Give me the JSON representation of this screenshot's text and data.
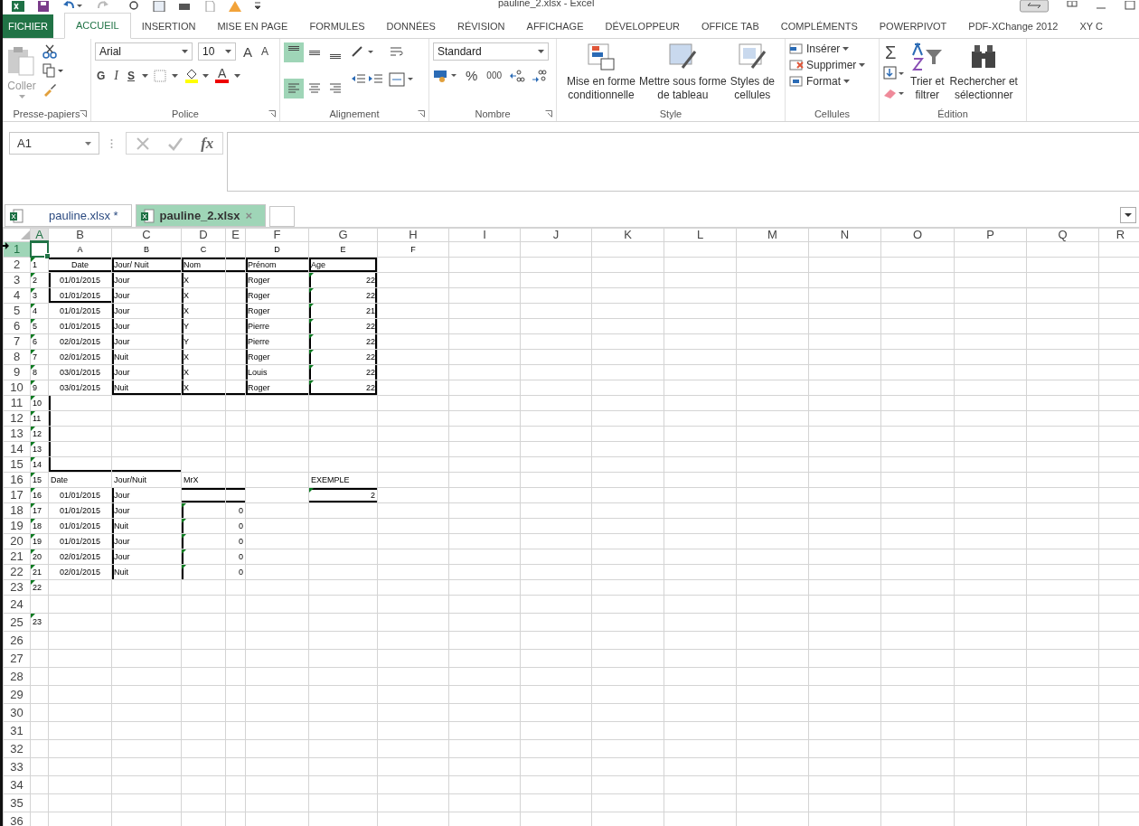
{
  "window": {
    "title": "pauline_2.xlsx - Excel"
  },
  "tabs": [
    {
      "label": "FICHIER",
      "kind": "file",
      "selected": false
    },
    {
      "label": "ACCUEIL",
      "kind": "tab",
      "selected": true
    },
    {
      "label": "INSERTION",
      "kind": "tab",
      "selected": false
    },
    {
      "label": "MISE EN PAGE",
      "kind": "tab",
      "selected": false
    },
    {
      "label": "FORMULES",
      "kind": "tab",
      "selected": false
    },
    {
      "label": "DONNÉES",
      "kind": "tab",
      "selected": false
    },
    {
      "label": "RÉVISION",
      "kind": "tab",
      "selected": false
    },
    {
      "label": "AFFICHAGE",
      "kind": "tab",
      "selected": false
    },
    {
      "label": "DÉVELOPPEUR",
      "kind": "tab",
      "selected": false
    },
    {
      "label": "OFFICE TAB",
      "kind": "tab",
      "selected": false
    },
    {
      "label": "COMPLÉMENTS",
      "kind": "tab",
      "selected": false
    },
    {
      "label": "POWERPIVOT",
      "kind": "tab",
      "selected": false
    },
    {
      "label": "PDF-XChange 2012",
      "kind": "tab",
      "selected": false
    },
    {
      "label": "XY C",
      "kind": "tab",
      "selected": false
    }
  ],
  "ribbon": {
    "clipboard": {
      "label": "Presse-papiers",
      "paste": "Coller"
    },
    "font": {
      "label": "Police",
      "font_name": "Arial",
      "font_size": "10",
      "grow": "A",
      "shrink": "A",
      "bold": "G",
      "italic": "I",
      "underline": "S",
      "font_color": "A"
    },
    "alignment": {
      "label": "Alignement",
      "buttons": [
        {
          "kind": "top",
          "selected": true
        },
        {
          "kind": "middle",
          "selected": false
        },
        {
          "kind": "bottom",
          "selected": false
        },
        {
          "kind": "left",
          "selected": true
        },
        {
          "kind": "center",
          "selected": false
        },
        {
          "kind": "right",
          "selected": false
        }
      ]
    },
    "number": {
      "label": "Nombre",
      "format": "Standard",
      "percent": "%",
      "thousands": "000"
    },
    "styles": {
      "label": "Style",
      "buttons": [
        {
          "kind": "conditional",
          "lines": [
            "Mise en forme",
            "conditionnelle"
          ]
        },
        {
          "kind": "table",
          "lines": [
            "Mettre sous forme",
            "de tableau"
          ]
        },
        {
          "kind": "cellstyle",
          "lines": [
            "Styles de",
            "cellules"
          ]
        }
      ]
    },
    "cells": {
      "label": "Cellules",
      "buttons": [
        {
          "kind": "insert",
          "label": "Insérer"
        },
        {
          "kind": "delete",
          "label": "Supprimer"
        },
        {
          "kind": "format",
          "label": "Format"
        }
      ]
    },
    "editing": {
      "label": "Édition",
      "sum": "Σ",
      "buttons": [
        {
          "kind": "sort",
          "lines": [
            "Trier et",
            "filtrer"
          ]
        },
        {
          "kind": "find",
          "lines": [
            "Rechercher et",
            "sélectionner"
          ]
        }
      ]
    }
  },
  "formula_bar": {
    "name_box": "A1",
    "fx": "fx"
  },
  "workbooks": [
    {
      "label": "pauline.xlsx *",
      "selected": false
    },
    {
      "label": "pauline_2.xlsx",
      "selected": true,
      "close": "×"
    }
  ],
  "sheet": {
    "columns": [
      {
        "label": "A",
        "selected": true
      },
      {
        "label": "B",
        "selected": false
      },
      {
        "label": "C",
        "selected": false
      },
      {
        "label": "D",
        "selected": false
      },
      {
        "label": "E",
        "selected": false
      },
      {
        "label": "F",
        "selected": false
      },
      {
        "label": "G",
        "selected": false
      },
      {
        "label": "H",
        "selected": false
      },
      {
        "label": "I",
        "selected": false
      },
      {
        "label": "J",
        "selected": false
      },
      {
        "label": "K",
        "selected": false
      },
      {
        "label": "L",
        "selected": false
      },
      {
        "label": "M",
        "selected": false
      },
      {
        "label": "N",
        "selected": false
      },
      {
        "label": "O",
        "selected": false
      },
      {
        "label": "P",
        "selected": false
      },
      {
        "label": "Q",
        "selected": false
      },
      {
        "label": "R",
        "selected": false
      }
    ],
    "rows": [
      {
        "header": "1",
        "selected": true,
        "cells": {
          "B": {
            "text": "A"
          },
          "C": {
            "text": "B"
          },
          "D": {
            "text": "C"
          },
          "F": {
            "text": "D"
          },
          "G": {
            "text": "E"
          },
          "H": {
            "text": "F"
          }
        }
      },
      {
        "header": "2",
        "selected": false,
        "cells": {
          "A": {
            "text": "1",
            "warning": true
          },
          "B": {
            "text": "Date"
          },
          "C": {
            "text": "Jour/ Nuit"
          },
          "D": {
            "text": "Nom"
          },
          "F": {
            "text": "Prénom"
          },
          "G": {
            "text": "Age"
          }
        }
      },
      {
        "header": "3",
        "selected": false,
        "cells": {
          "A": {
            "text": "2",
            "warning": true
          },
          "B": {
            "text": "01/01/2015"
          },
          "C": {
            "text": "Jour"
          },
          "D": {
            "text": "X"
          },
          "F": {
            "text": "Roger"
          },
          "G": {
            "text": "22",
            "warning": true
          }
        }
      },
      {
        "header": "4",
        "selected": false,
        "cells": {
          "A": {
            "text": "3",
            "warning": true
          },
          "B": {
            "text": "01/01/2015"
          },
          "C": {
            "text": "Jour"
          },
          "D": {
            "text": "X"
          },
          "F": {
            "text": "Roger"
          },
          "G": {
            "text": "22",
            "warning": true
          }
        }
      },
      {
        "header": "5",
        "selected": false,
        "cells": {
          "A": {
            "text": "4",
            "warning": true
          },
          "B": {
            "text": "01/01/2015"
          },
          "C": {
            "text": "Jour"
          },
          "D": {
            "text": "X"
          },
          "F": {
            "text": "Roger"
          },
          "G": {
            "text": "21",
            "warning": true
          }
        }
      },
      {
        "header": "6",
        "selected": false,
        "cells": {
          "A": {
            "text": "5",
            "warning": true
          },
          "B": {
            "text": "01/01/2015"
          },
          "C": {
            "text": "Jour"
          },
          "D": {
            "text": "Y"
          },
          "F": {
            "text": "Pierre"
          },
          "G": {
            "text": "22",
            "warning": true
          }
        }
      },
      {
        "header": "7",
        "selected": false,
        "cells": {
          "A": {
            "text": "6",
            "warning": true
          },
          "B": {
            "text": "02/01/2015"
          },
          "C": {
            "text": "Jour"
          },
          "D": {
            "text": "Y"
          },
          "F": {
            "text": "Pierre"
          },
          "G": {
            "text": "22",
            "warning": true
          }
        }
      },
      {
        "header": "8",
        "selected": false,
        "cells": {
          "A": {
            "text": "7",
            "warning": true
          },
          "B": {
            "text": "02/01/2015"
          },
          "C": {
            "text": "Nuit"
          },
          "D": {
            "text": "X"
          },
          "F": {
            "text": "Roger"
          },
          "G": {
            "text": "22",
            "warning": true
          }
        }
      },
      {
        "header": "9",
        "selected": false,
        "cells": {
          "A": {
            "text": "8",
            "warning": true
          },
          "B": {
            "text": "03/01/2015"
          },
          "C": {
            "text": "Jour"
          },
          "D": {
            "text": "X"
          },
          "F": {
            "text": "Louis"
          },
          "G": {
            "text": "22",
            "warning": true
          }
        }
      },
      {
        "header": "10",
        "selected": false,
        "cells": {
          "A": {
            "text": "9",
            "warning": true
          },
          "B": {
            "text": "03/01/2015"
          },
          "C": {
            "text": "Nuit"
          },
          "D": {
            "text": "X"
          },
          "F": {
            "text": "Roger"
          },
          "G": {
            "text": "22",
            "warning": true
          }
        }
      },
      {
        "header": "11",
        "selected": false,
        "cells": {
          "A": {
            "text": "10",
            "warning": true
          }
        }
      },
      {
        "header": "12",
        "selected": false,
        "cells": {
          "A": {
            "text": "11",
            "warning": true
          }
        }
      },
      {
        "header": "13",
        "selected": false,
        "cells": {
          "A": {
            "text": "12",
            "warning": true
          }
        }
      },
      {
        "header": "14",
        "selected": false,
        "cells": {
          "A": {
            "text": "13",
            "warning": true
          }
        }
      },
      {
        "header": "15",
        "selected": false,
        "cells": {
          "A": {
            "text": "14",
            "warning": true
          }
        }
      },
      {
        "header": "16",
        "selected": false,
        "cells": {
          "A": {
            "text": "15",
            "warning": true
          },
          "B": {
            "text": "Date"
          },
          "C": {
            "text": "Jour/Nuit"
          },
          "D": {
            "text": "MrX"
          },
          "G": {
            "text": "EXEMPLE"
          }
        }
      },
      {
        "header": "17",
        "selected": false,
        "cells": {
          "A": {
            "text": "16",
            "warning": true
          },
          "B": {
            "text": "01/01/2015"
          },
          "C": {
            "text": "Jour"
          },
          "G": {
            "text": "2",
            "warning": true
          }
        }
      },
      {
        "header": "18",
        "selected": false,
        "cells": {
          "A": {
            "text": "17",
            "warning": true
          },
          "B": {
            "text": "01/01/2015"
          },
          "C": {
            "text": "Jour"
          },
          "D": {
            "warning": true
          },
          "E": {
            "text": "0"
          }
        }
      },
      {
        "header": "19",
        "selected": false,
        "cells": {
          "A": {
            "text": "18",
            "warning": true
          },
          "B": {
            "text": "01/01/2015"
          },
          "C": {
            "text": "Nuit"
          },
          "D": {
            "warning": true
          },
          "E": {
            "text": "0"
          }
        }
      },
      {
        "header": "20",
        "selected": false,
        "cells": {
          "A": {
            "text": "19",
            "warning": true
          },
          "B": {
            "text": "01/01/2015"
          },
          "C": {
            "text": "Jour"
          },
          "D": {
            "warning": true
          },
          "E": {
            "text": "0"
          }
        }
      },
      {
        "header": "21",
        "selected": false,
        "cells": {
          "A": {
            "text": "20",
            "warning": true
          },
          "B": {
            "text": "02/01/2015"
          },
          "C": {
            "text": "Jour"
          },
          "D": {
            "warning": true
          },
          "E": {
            "text": "0"
          }
        }
      },
      {
        "header": "22",
        "selected": false,
        "cells": {
          "A": {
            "text": "21",
            "warning": true
          },
          "B": {
            "text": "02/01/2015"
          },
          "C": {
            "text": "Nuit"
          },
          "D": {
            "warning": true
          },
          "E": {
            "text": "0"
          }
        }
      },
      {
        "header": "23",
        "selected": false,
        "cells": {
          "A": {
            "text": "22",
            "warning": true
          }
        }
      },
      {
        "header": "24",
        "selected": false,
        "cells": {}
      },
      {
        "header": "25",
        "selected": false,
        "cells": {
          "A": {
            "text": "23",
            "warning": true
          }
        }
      },
      {
        "header": "26",
        "selected": false,
        "cells": {}
      },
      {
        "header": "27",
        "selected": false,
        "cells": {}
      },
      {
        "header": "28",
        "selected": false,
        "cells": {}
      },
      {
        "header": "29",
        "selected": false,
        "cells": {}
      },
      {
        "header": "30",
        "selected": false,
        "cells": {}
      },
      {
        "header": "31",
        "selected": false,
        "cells": {}
      },
      {
        "header": "32",
        "selected": false,
        "cells": {}
      },
      {
        "header": "33",
        "selected": false,
        "cells": {}
      },
      {
        "header": "34",
        "selected": false,
        "cells": {}
      },
      {
        "header": "35",
        "selected": false,
        "cells": {}
      },
      {
        "header": "36",
        "selected": false,
        "cells": {}
      }
    ]
  }
}
